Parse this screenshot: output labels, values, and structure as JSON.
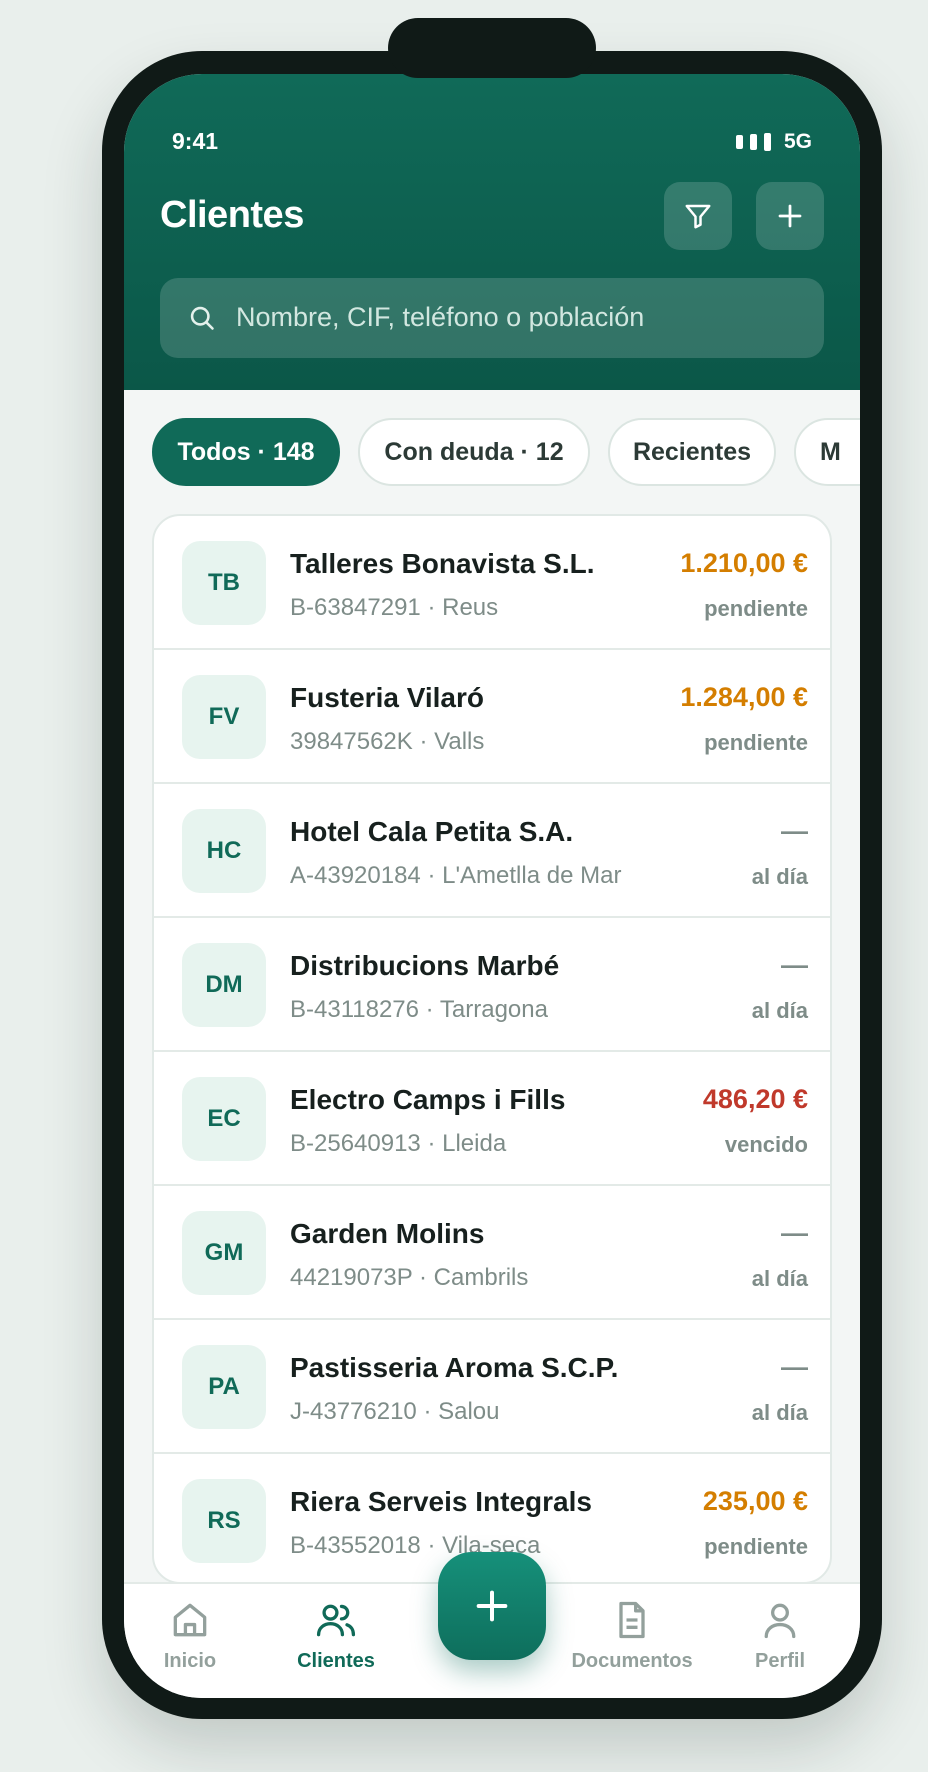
{
  "status": {
    "time": "9:41",
    "network": "5G"
  },
  "header": {
    "title": "Clientes"
  },
  "search": {
    "placeholder": "Nombre, CIF, teléfono o población"
  },
  "chips": [
    {
      "label": "Todos · 148",
      "active": true
    },
    {
      "label": "Con deuda · 12",
      "active": false
    },
    {
      "label": "Recientes",
      "active": false
    },
    {
      "label": "M",
      "active": false
    }
  ],
  "clients": [
    {
      "initials": "TB",
      "name": "Talleres Bonavista S.L.",
      "sub": "B-63847291 · Reus",
      "amount": "1.210,00 €",
      "status": "pendiente"
    },
    {
      "initials": "FV",
      "name": "Fusteria Vilaró",
      "sub": "39847562K · Valls",
      "amount": "1.284,00 €",
      "status": "pendiente"
    },
    {
      "initials": "HC",
      "name": "Hotel Cala Petita S.A.",
      "sub": "A-43920184 · L'Ametlla de Mar",
      "amount": "—",
      "status": "al día"
    },
    {
      "initials": "DM",
      "name": "Distribucions Marbé",
      "sub": "B-43118276 · Tarragona",
      "amount": "—",
      "status": "al día"
    },
    {
      "initials": "EC",
      "name": "Electro Camps i Fills",
      "sub": "B-25640913 · Lleida",
      "amount": "486,20 €",
      "status": "vencido"
    },
    {
      "initials": "GM",
      "name": "Garden Molins",
      "sub": "44219073P · Cambrils",
      "amount": "—",
      "status": "al día"
    },
    {
      "initials": "PA",
      "name": "Pastisseria Aroma S.C.P.",
      "sub": "J-43776210 · Salou",
      "amount": "—",
      "status": "al día"
    },
    {
      "initials": "RS",
      "name": "Riera Serveis Integrals",
      "sub": "B-43552018 · Vila-seca",
      "amount": "235,00 €",
      "status": "pendiente"
    }
  ],
  "tabs": [
    {
      "label": "Inicio",
      "icon": "home-icon",
      "active": false
    },
    {
      "label": "Clientes",
      "icon": "users-icon",
      "active": true
    },
    {
      "label": "Documentos",
      "icon": "document-icon",
      "active": false
    },
    {
      "label": "Perfil",
      "icon": "user-icon",
      "active": false
    }
  ],
  "colors": {
    "brand": "#106a58",
    "pendiente": "#d47e00",
    "vencido": "#c0392b",
    "al_dia": "#7e8c88"
  }
}
